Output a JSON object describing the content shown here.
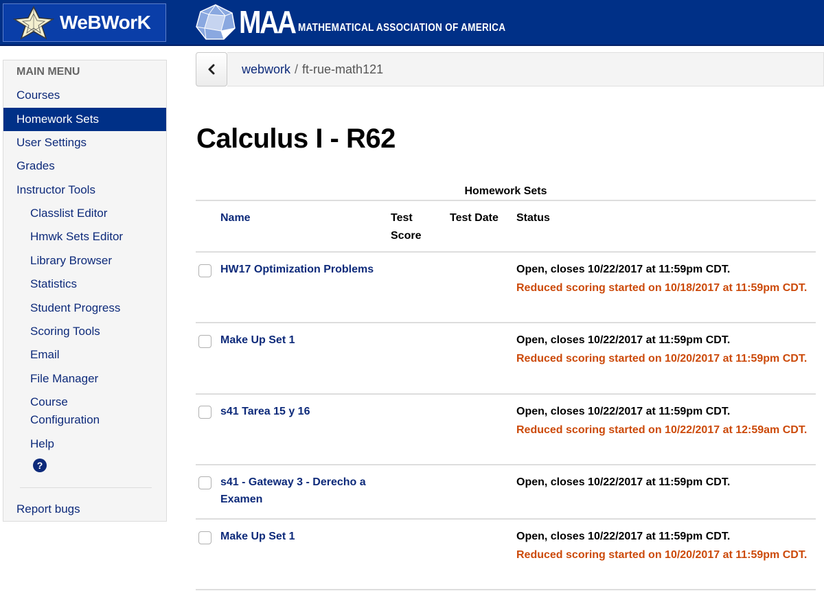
{
  "header": {
    "brand_name": "WeBWorK",
    "maa_abbrev": "MAA",
    "maa_full": "MATHEMATICAL ASSOCIATION OF AMERICA"
  },
  "sidebar": {
    "title": "MAIN MENU",
    "items": [
      {
        "label": "Courses",
        "active": false,
        "sub": false
      },
      {
        "label": "Homework Sets",
        "active": true,
        "sub": false
      },
      {
        "label": "User Settings",
        "active": false,
        "sub": false
      },
      {
        "label": "Grades",
        "active": false,
        "sub": false
      },
      {
        "label": "Instructor Tools",
        "active": false,
        "sub": false
      },
      {
        "label": "Classlist Editor",
        "active": false,
        "sub": true
      },
      {
        "label": "Hmwk Sets Editor",
        "active": false,
        "sub": true
      },
      {
        "label": "Library Browser",
        "active": false,
        "sub": true
      },
      {
        "label": "Statistics",
        "active": false,
        "sub": true
      },
      {
        "label": "Student Progress",
        "active": false,
        "sub": true
      },
      {
        "label": "Scoring Tools",
        "active": false,
        "sub": true
      },
      {
        "label": "Email",
        "active": false,
        "sub": true
      },
      {
        "label": "File Manager",
        "active": false,
        "sub": true
      },
      {
        "label": "Course Configuration",
        "active": false,
        "sub": true
      },
      {
        "label": "Help",
        "active": false,
        "sub": true
      }
    ],
    "help_icon": "question-circle-icon",
    "report_bugs": "Report bugs"
  },
  "breadcrumb": {
    "back_icon": "chevron-left-icon",
    "root": "webwork",
    "separator": "/",
    "current": "ft-rue-math121"
  },
  "page": {
    "title": "Calculus I - R62"
  },
  "table": {
    "caption": "Homework Sets",
    "columns": [
      "Name",
      "Test Score",
      "Test Date",
      "Status"
    ],
    "rows": [
      {
        "name": "HW17 Optimization Problems",
        "status": "Open, closes 10/22/2017 at 11:59pm CDT.",
        "reduced": "Reduced scoring started on 10/18/2017 at 11:59pm CDT.",
        "checked": false
      },
      {
        "name": "Make Up Set 1",
        "status": "Open, closes 10/22/2017 at 11:59pm CDT.",
        "reduced": "Reduced scoring started on 10/20/2017 at 11:59pm CDT.",
        "checked": false
      },
      {
        "name": "s41 Tarea 15 y 16",
        "status": "Open, closes 10/22/2017 at 11:59pm CDT.",
        "reduced": "Reduced scoring started on 10/22/2017 at 12:59am CDT.",
        "checked": false
      },
      {
        "name": "s41 - Gateway 3 - Derecho a Examen",
        "status": "Open, closes 10/22/2017 at 11:59pm CDT.",
        "reduced": null,
        "checked": false
      },
      {
        "name": "Make Up Set 1",
        "status": "Open, closes 10/22/2017 at 11:59pm CDT.",
        "reduced": "Reduced scoring started on 10/20/2017 at 11:59pm CDT.",
        "checked": false
      }
    ]
  },
  "colors": {
    "brand_blue": "#003087",
    "link_blue": "#0d2a7a",
    "reduced_orange": "#cc4a0a"
  }
}
